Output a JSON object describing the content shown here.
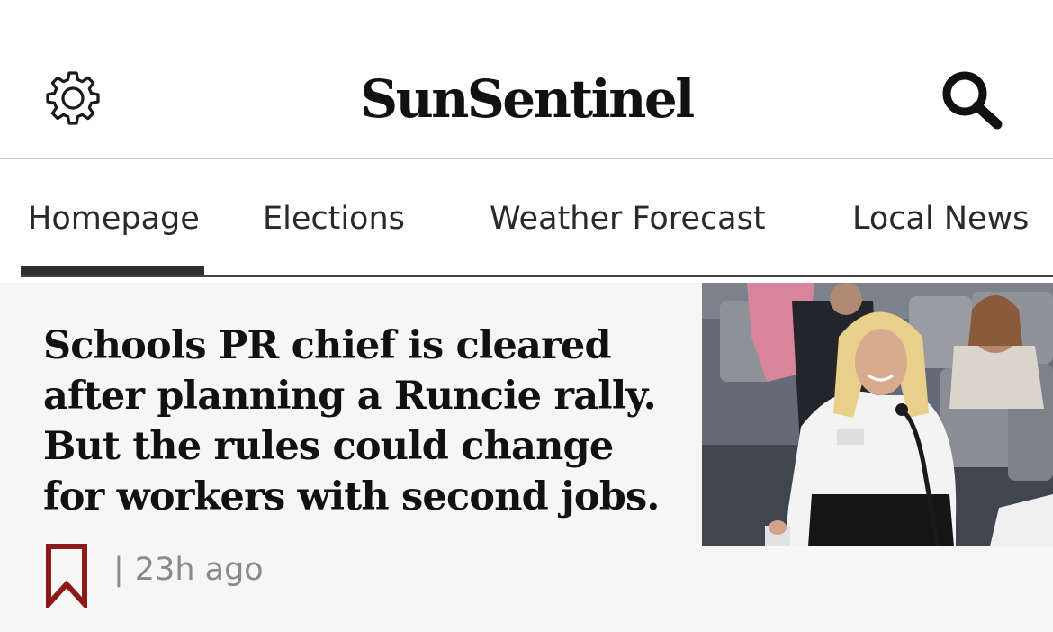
{
  "header": {
    "logo": "SunSentinel",
    "settings_icon": "gear-icon",
    "search_icon": "search-icon"
  },
  "tabs": [
    {
      "label": "Homepage",
      "selected": true
    },
    {
      "label": "Elections",
      "selected": false
    },
    {
      "label": "Weather Forecast",
      "selected": false
    },
    {
      "label": "Local News",
      "selected": false
    }
  ],
  "story": {
    "headline": "Schools PR chief is cleared after planning a Runcie rally. But the rules could change for workers with second jobs.",
    "separator": "|",
    "time_ago": "23h ago",
    "bookmark_icon": "bookmark-icon"
  },
  "colors": {
    "bookmark": "#8c1a1a",
    "tab_indicator": "#2f2f2f",
    "story_background": "#f6f6f6",
    "meta_text": "#8a8a8a"
  }
}
